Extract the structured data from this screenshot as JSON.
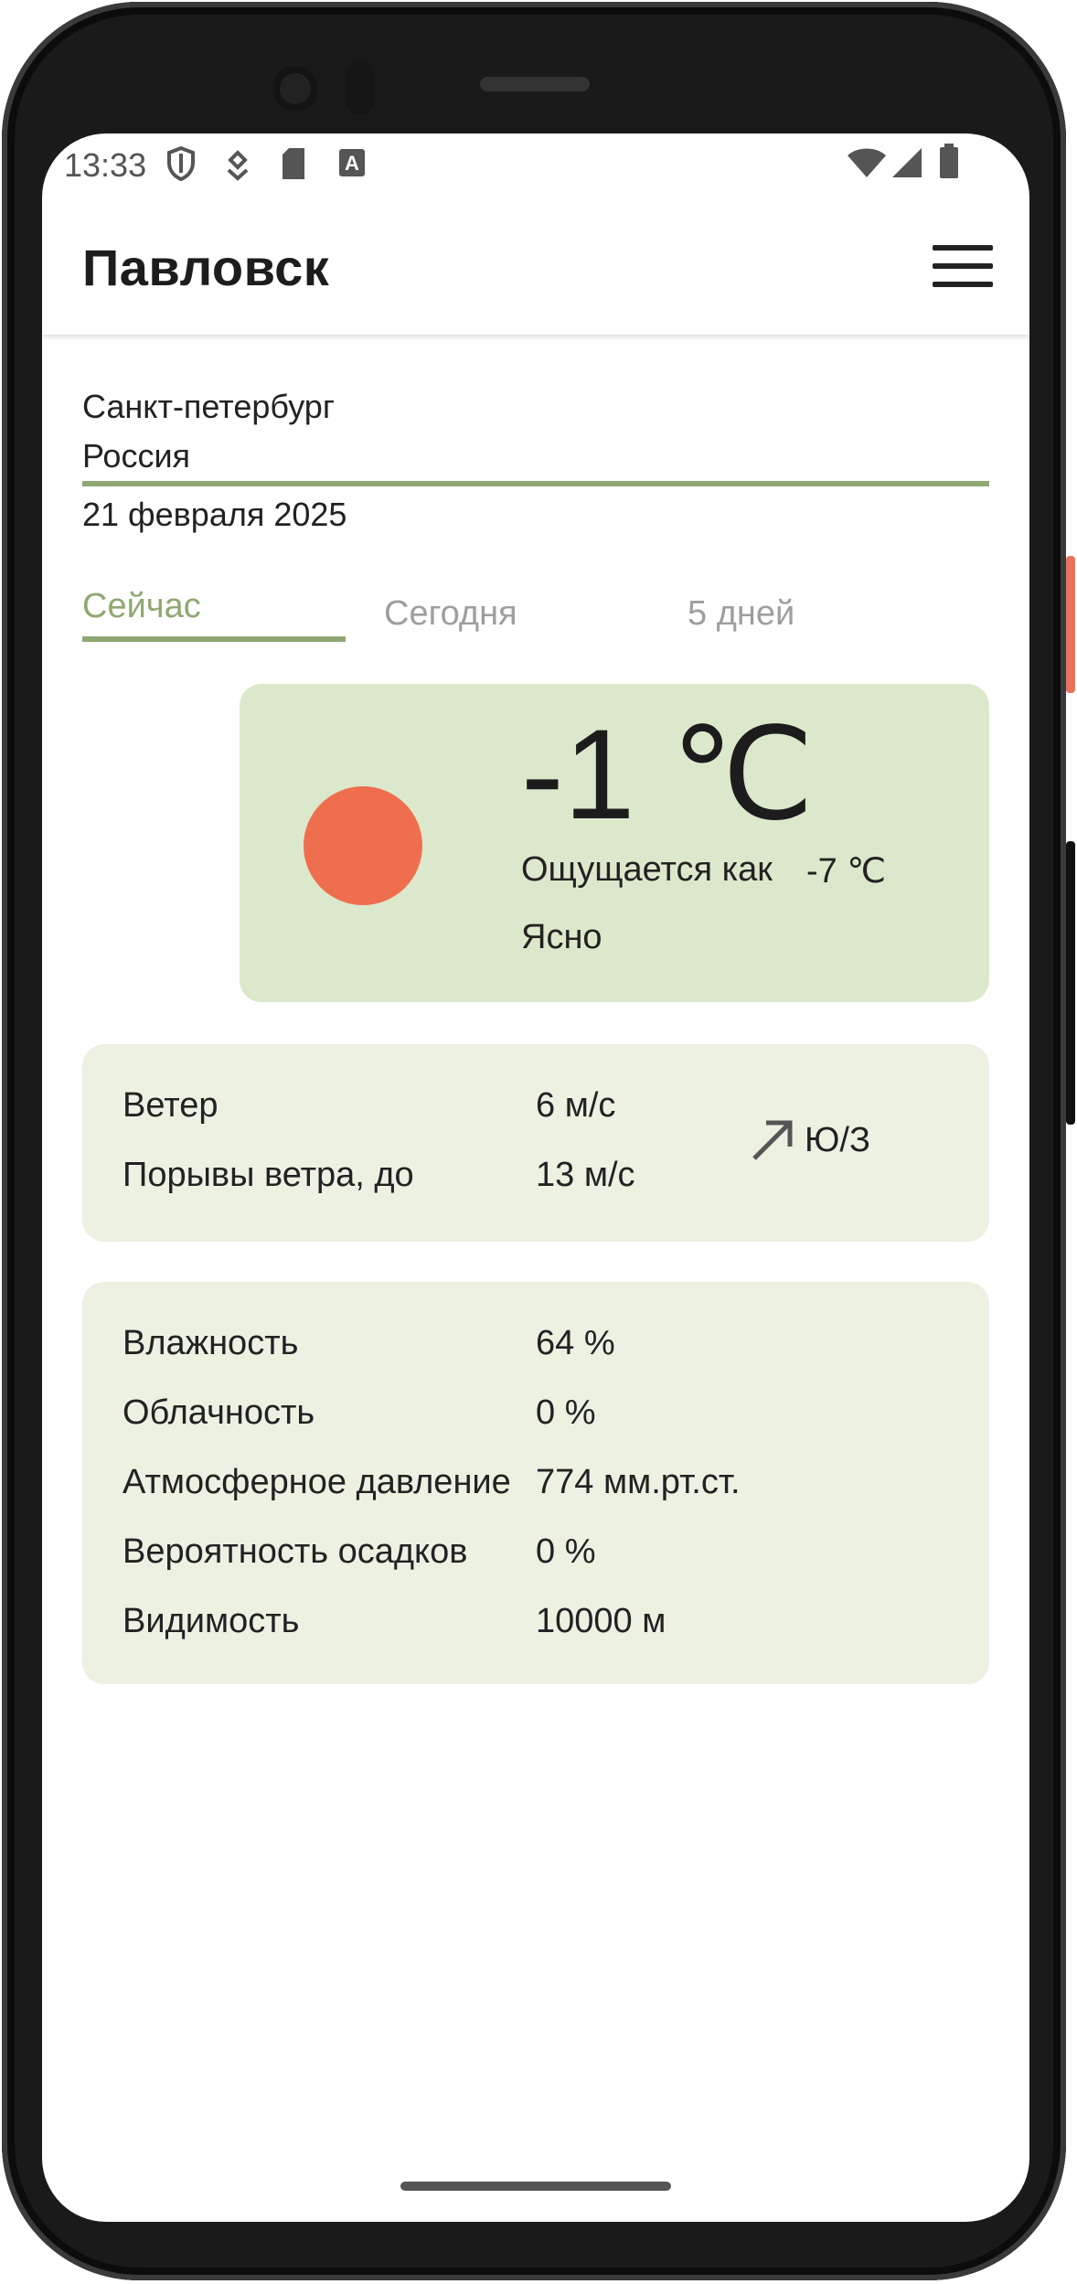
{
  "status_bar": {
    "time": "13:33",
    "left_icons": [
      "shield-icon",
      "download-icon",
      "sd-card-icon",
      "text-a-icon"
    ],
    "right_icons": [
      "wifi-icon",
      "signal-icon",
      "battery-icon"
    ]
  },
  "app_bar": {
    "title": "Павловск",
    "menu_icon": "hamburger-menu-icon"
  },
  "location": {
    "city": "Санкт-петербург",
    "country": "Россия",
    "date": "21 февраля 2025"
  },
  "tabs": [
    {
      "label": "Сейчас",
      "active": true
    },
    {
      "label": "Сегодня",
      "active": false
    },
    {
      "label": "5 дней",
      "active": false
    }
  ],
  "current": {
    "icon": "sun-icon",
    "temperature": "-1 ℃",
    "feels_like_label": "Ощущается как",
    "feels_like_value": "-7 ℃",
    "condition": "Ясно"
  },
  "wind": {
    "wind_label": "Ветер",
    "wind_value": "6 м/с",
    "gusts_label": "Порывы ветра, до",
    "gusts_value": "13 м/с",
    "direction": "Ю/З",
    "direction_icon": "arrow-up-right-icon"
  },
  "stats": [
    {
      "label": "Влажность",
      "value": "64 %"
    },
    {
      "label": "Облачность",
      "value": "0 %"
    },
    {
      "label": "Атмосферное давление",
      "value": "774 мм.рт.ст."
    },
    {
      "label": "Вероятность осадков",
      "value": "0 %"
    },
    {
      "label": "Видимость",
      "value": "10000 м"
    }
  ],
  "colors": {
    "accent": "#8fa873",
    "main_card_bg": "#dce8cc",
    "secondary_card_bg": "#ecf1e2",
    "sun": "#ee6e4e"
  }
}
